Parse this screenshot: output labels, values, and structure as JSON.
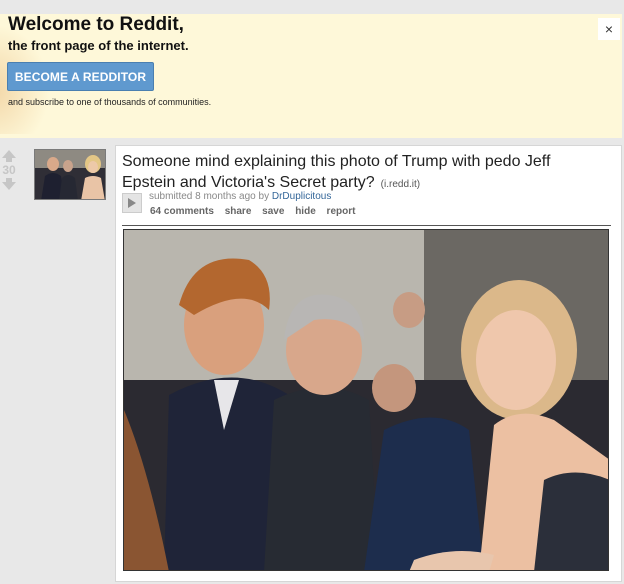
{
  "welcome": {
    "title": "Welcome to Reddit,",
    "tagline": "the front page of the internet.",
    "cta_label": "BECOME A REDDITOR",
    "subtext": "and subscribe to one of thousands of communities.",
    "close_label": "×"
  },
  "post": {
    "score": "30",
    "title": "Someone mind explaining this photo of Trump with pedo Jeff Epstein and Victoria's Secret party?",
    "domain": "(i.redd.it)",
    "submitted_prefix": "submitted 8 months ago by",
    "author": "DrDuplicitous",
    "buttons": {
      "comments": "64 comments",
      "share": "share",
      "save": "save",
      "hide": "hide",
      "report": "report"
    }
  },
  "colors": {
    "banner_bg": "#fef8d9",
    "cta_button": "#5f99cf",
    "author_link": "#336699",
    "vote_arrow": "#c6c6c6"
  },
  "icons": [
    "upvote-icon",
    "downvote-icon",
    "close-icon",
    "expand-play-icon"
  ]
}
